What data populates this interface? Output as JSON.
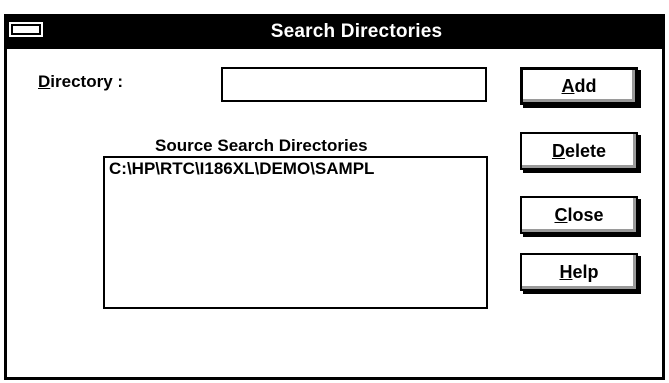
{
  "window": {
    "title": "Search Directories"
  },
  "directory": {
    "label_mnemonic": "D",
    "label_rest": "irectory :",
    "value": ""
  },
  "source_list": {
    "label": "Source Search Directories",
    "items": [
      "C:\\HP\\RTC\\I186XL\\DEMO\\SAMPL"
    ]
  },
  "buttons": {
    "add": {
      "mnemonic": "A",
      "rest": "dd"
    },
    "delete": {
      "mnemonic": "D",
      "rest": "elete"
    },
    "close": {
      "mnemonic": "C",
      "rest": "lose"
    },
    "help": {
      "mnemonic": "H",
      "rest": "elp"
    }
  }
}
